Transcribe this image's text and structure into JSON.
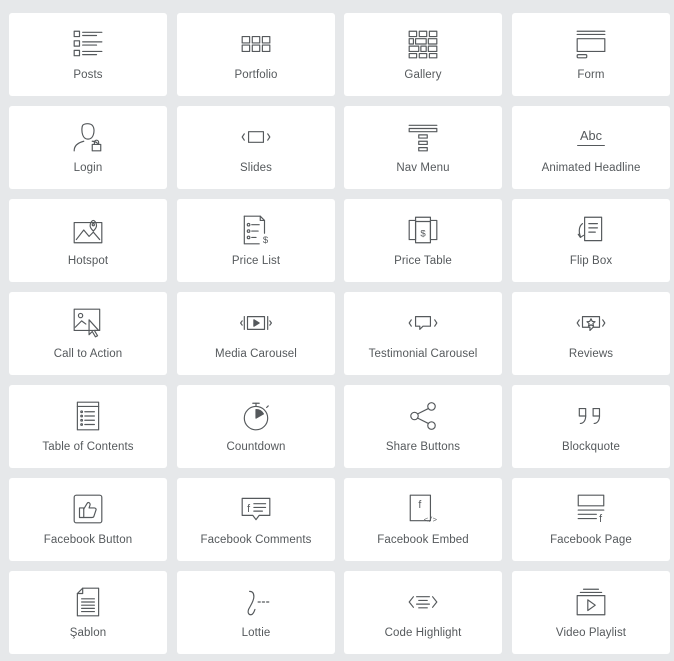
{
  "colors": {
    "background": "#e6e8ea",
    "tile": "#ffffff",
    "icon": "#55595c",
    "label": "#55595c"
  },
  "widgets": [
    {
      "label": "Posts",
      "icon": "posts-icon"
    },
    {
      "label": "Portfolio",
      "icon": "portfolio-icon"
    },
    {
      "label": "Gallery",
      "icon": "gallery-icon"
    },
    {
      "label": "Form",
      "icon": "form-icon"
    },
    {
      "label": "Login",
      "icon": "login-icon"
    },
    {
      "label": "Slides",
      "icon": "slides-icon"
    },
    {
      "label": "Nav Menu",
      "icon": "nav-menu-icon"
    },
    {
      "label": "Animated Headline",
      "icon": "animated-headline-icon",
      "glyph": "Abc"
    },
    {
      "label": "Hotspot",
      "icon": "hotspot-icon"
    },
    {
      "label": "Price List",
      "icon": "price-list-icon"
    },
    {
      "label": "Price Table",
      "icon": "price-table-icon"
    },
    {
      "label": "Flip Box",
      "icon": "flip-box-icon"
    },
    {
      "label": "Call to Action",
      "icon": "call-to-action-icon"
    },
    {
      "label": "Media Carousel",
      "icon": "media-carousel-icon"
    },
    {
      "label": "Testimonial Carousel",
      "icon": "testimonial-carousel-icon"
    },
    {
      "label": "Reviews",
      "icon": "reviews-icon"
    },
    {
      "label": "Table of Contents",
      "icon": "table-of-contents-icon"
    },
    {
      "label": "Countdown",
      "icon": "countdown-icon"
    },
    {
      "label": "Share Buttons",
      "icon": "share-buttons-icon"
    },
    {
      "label": "Blockquote",
      "icon": "blockquote-icon"
    },
    {
      "label": "Facebook Button",
      "icon": "facebook-button-icon"
    },
    {
      "label": "Facebook Comments",
      "icon": "facebook-comments-icon"
    },
    {
      "label": "Facebook Embed",
      "icon": "facebook-embed-icon"
    },
    {
      "label": "Facebook Page",
      "icon": "facebook-page-icon"
    },
    {
      "label": "Şablon",
      "icon": "template-icon"
    },
    {
      "label": "Lottie",
      "icon": "lottie-icon"
    },
    {
      "label": "Code Highlight",
      "icon": "code-highlight-icon"
    },
    {
      "label": "Video Playlist",
      "icon": "video-playlist-icon"
    }
  ]
}
